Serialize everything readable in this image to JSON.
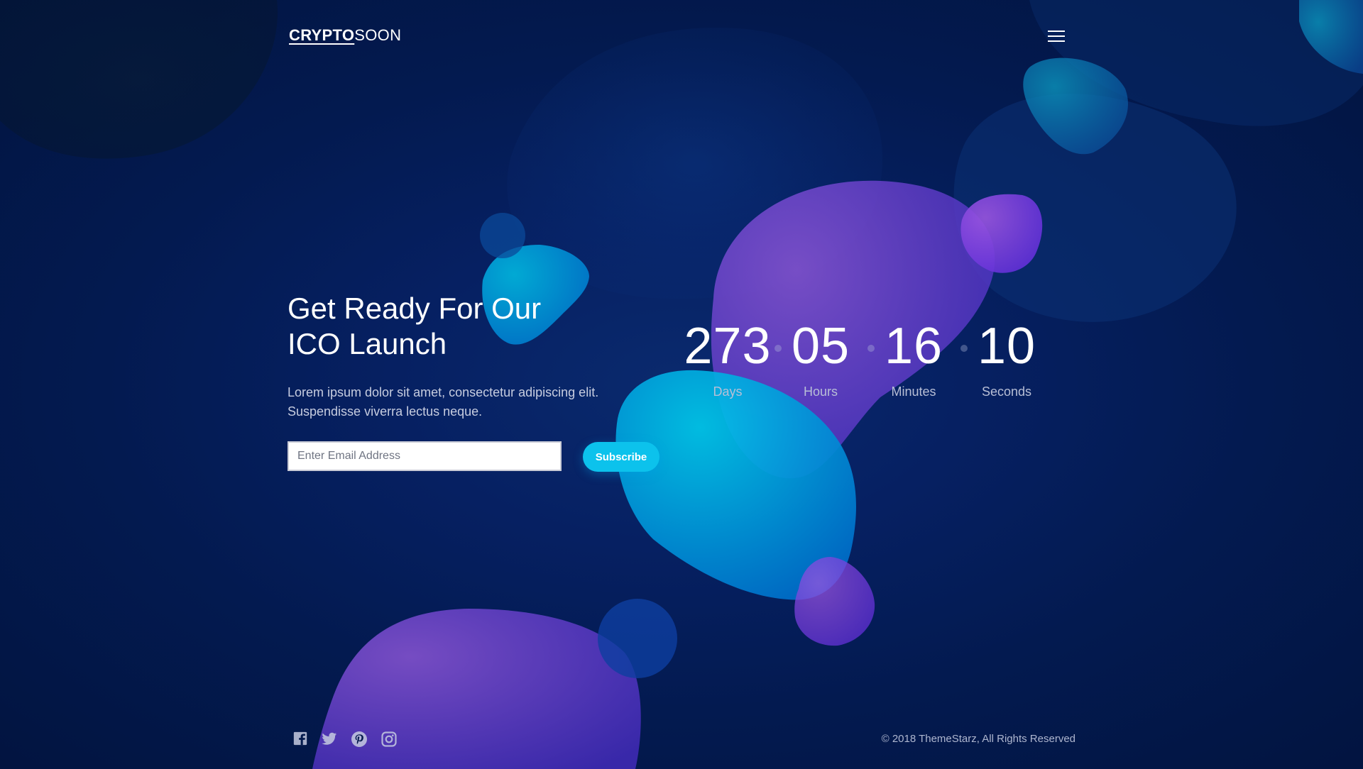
{
  "header": {
    "logo_bold": "CRYPTO",
    "logo_light": "SOON"
  },
  "hero": {
    "title_line1": "Get Ready For Our",
    "title_line2": "ICO Launch",
    "subtitle_line1": "Lorem ipsum dolor sit amet, consectetur adipiscing elit.",
    "subtitle_line2": "Suspendisse viverra lectus neque."
  },
  "subscribe": {
    "email_placeholder": "Enter Email Address",
    "email_value": "",
    "button_label": "Subscribe"
  },
  "countdown": {
    "days": "273",
    "days_label": "Days",
    "hours": "05",
    "hours_label": "Hours",
    "minutes": "16",
    "minutes_label": "Minutes",
    "seconds": "10",
    "seconds_label": "Seconds"
  },
  "footer": {
    "social": [
      "facebook-icon",
      "twitter-icon",
      "pinterest-icon",
      "instagram-icon"
    ],
    "copyright": "© 2018 ThemeStarz, All Rights Reserved"
  },
  "colors": {
    "background": "#031a50",
    "accent": "#0cc2ec",
    "blob_purple": "#6a3fd0",
    "blob_cyan": "#00b8e6"
  }
}
